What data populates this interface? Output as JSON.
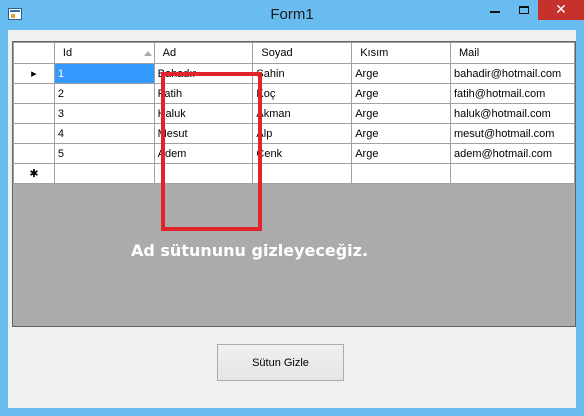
{
  "window": {
    "title": "Form1",
    "minimize_icon": "minimize-icon",
    "maximize_icon": "maximize-icon",
    "close_icon": "close-icon",
    "close_glyph": "✕"
  },
  "grid": {
    "columns": [
      "Id",
      "Ad",
      "Soyad",
      "Kısım",
      "Mail"
    ],
    "rows": [
      [
        "1",
        "Bahadır",
        "Şahin",
        "Arge",
        "bahadir@hotmail.com"
      ],
      [
        "2",
        "Fatih",
        "Koç",
        "Arge",
        "fatih@hotmail.com"
      ],
      [
        "3",
        "Haluk",
        "Akman",
        "Arge",
        "haluk@hotmail.com"
      ],
      [
        "4",
        "Mesut",
        "Alp",
        "Arge",
        "mesut@hotmail.com"
      ],
      [
        "5",
        "Adem",
        "Cenk",
        "Arge",
        "adem@hotmail.com"
      ]
    ],
    "current_row_marker": "▸",
    "new_row_marker": "✱",
    "selected_cell_value": "1"
  },
  "annotation": {
    "caption": "Ad sütununu gizleyeceğiz.",
    "highlight_color": "#e1242b"
  },
  "actions": {
    "hide_column_label": "Sütun Gizle"
  },
  "colors": {
    "titlebar": "#69bcef",
    "close_button": "#c7312b",
    "selection": "#3399ff",
    "grid_background": "#ababab"
  }
}
